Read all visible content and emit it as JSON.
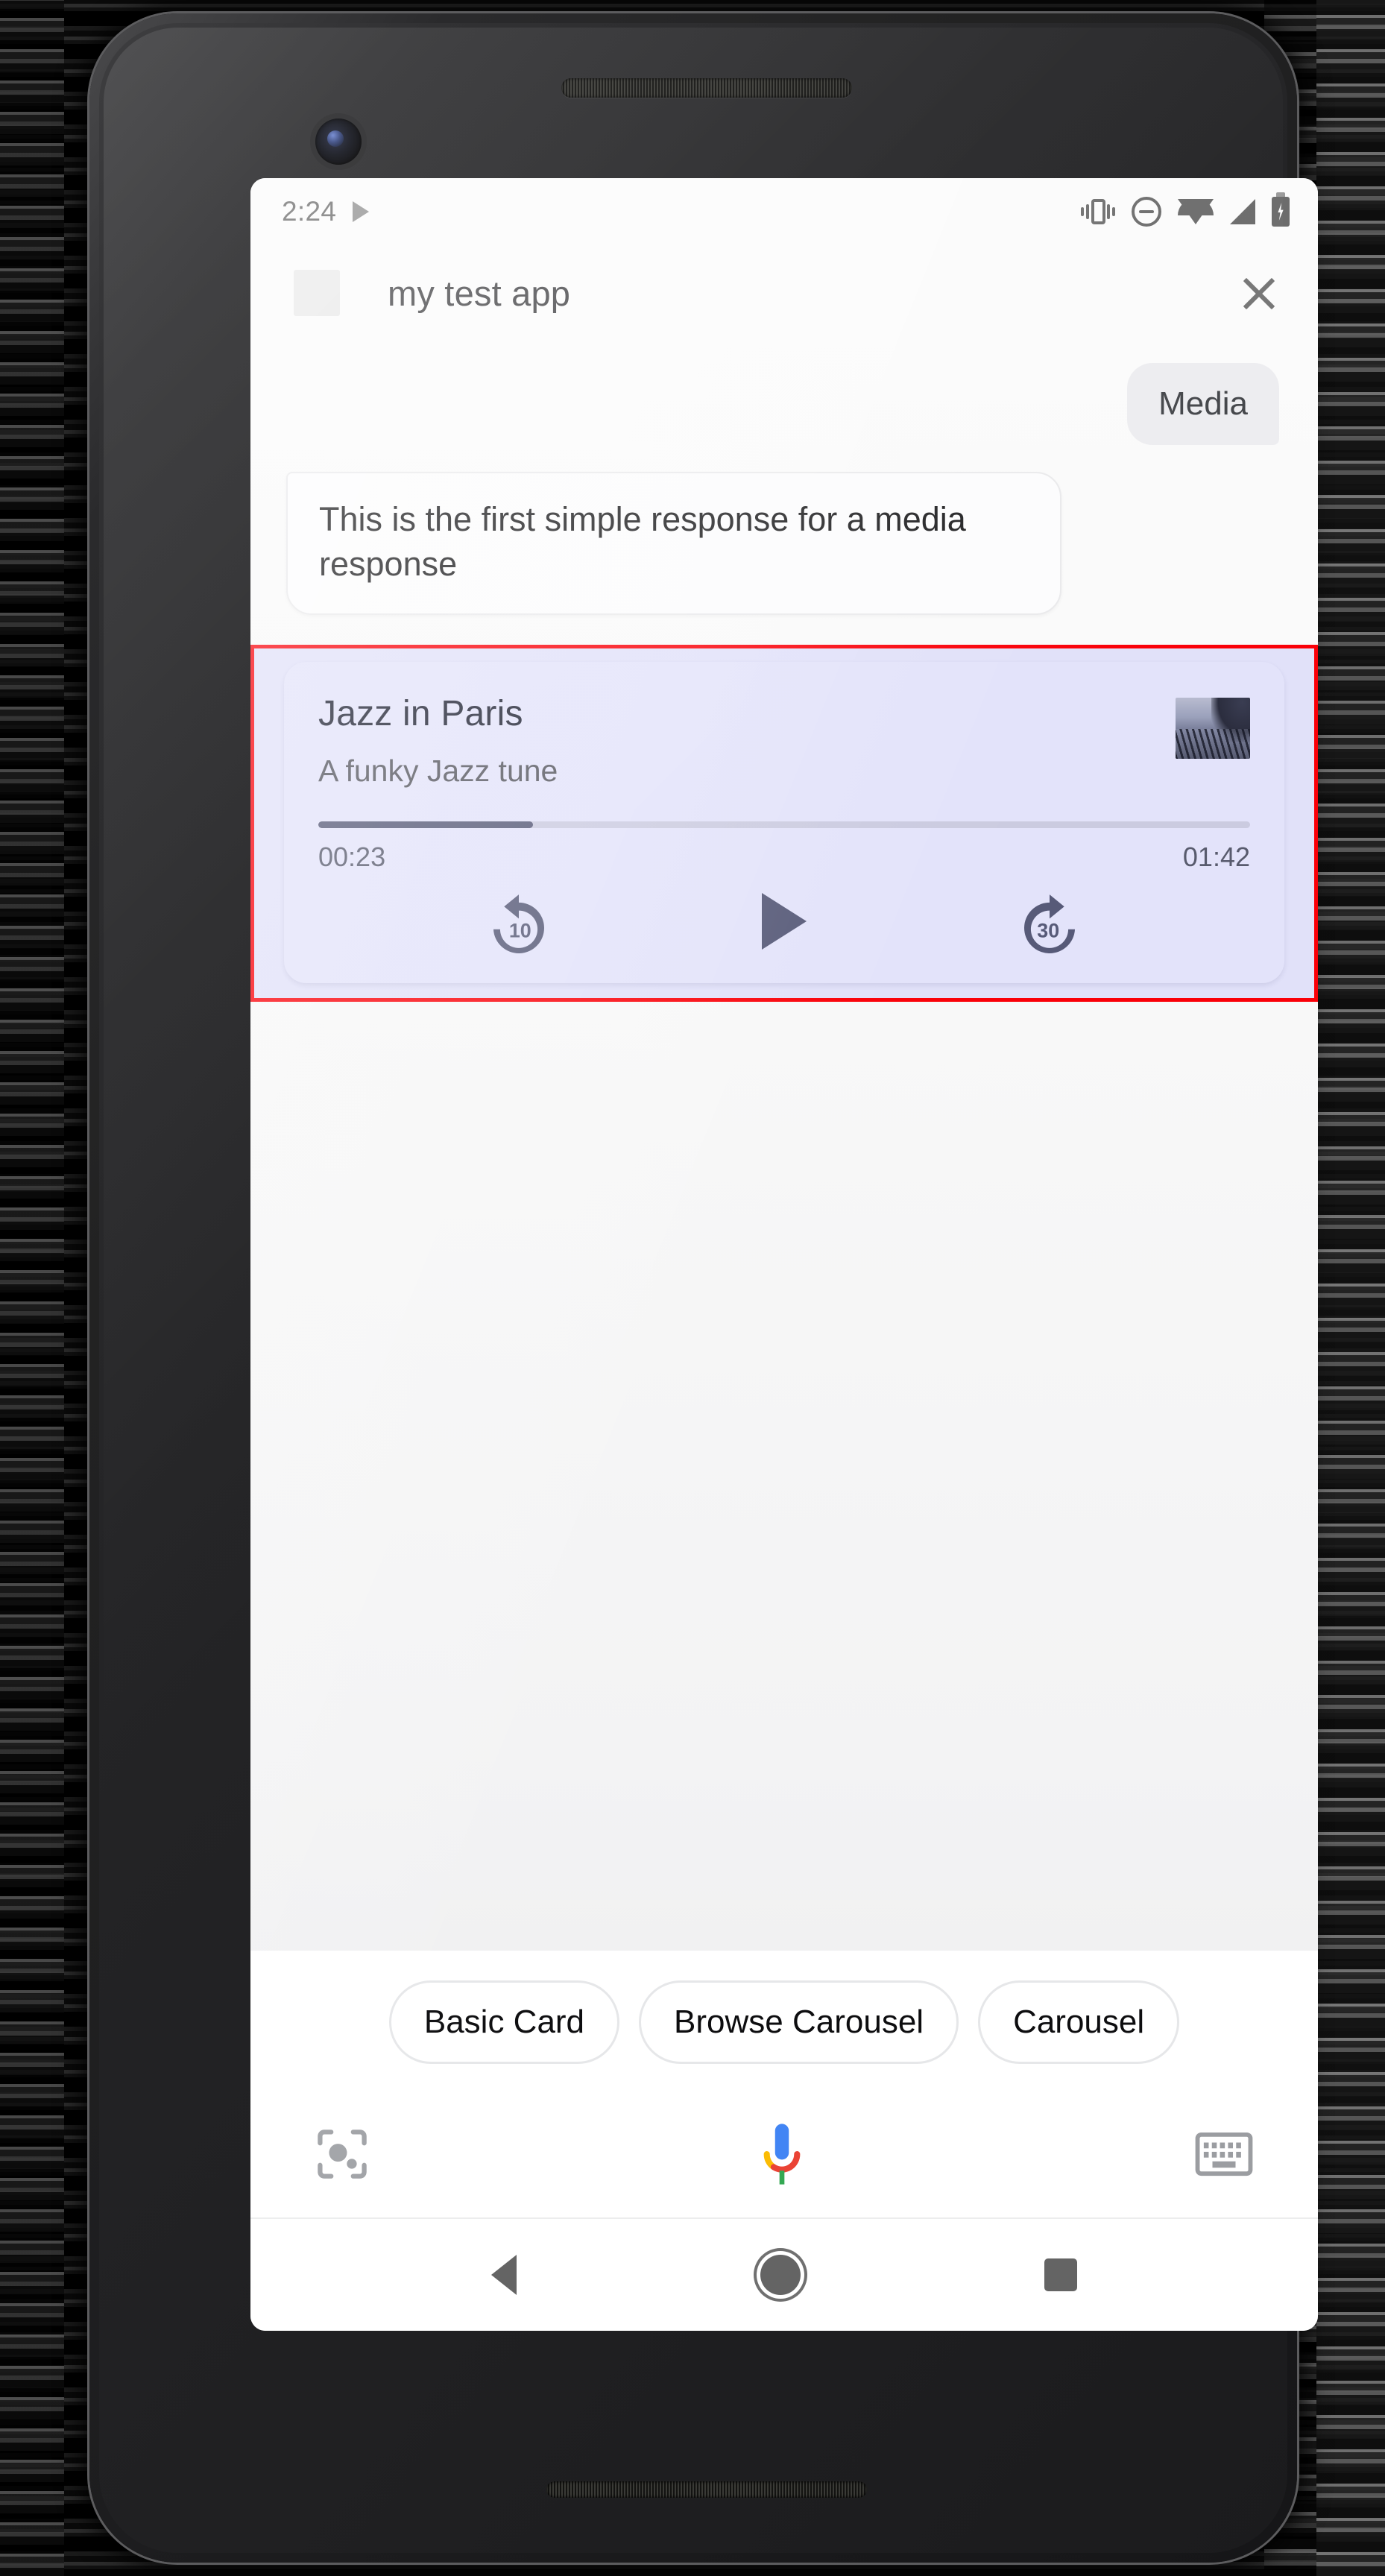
{
  "statusbar": {
    "time": "2:24",
    "icons": [
      "play-arrow-icon",
      "vibrate-icon",
      "do-not-disturb-icon",
      "wifi-icon",
      "cellular-signal-icon",
      "battery-charging-icon"
    ]
  },
  "header": {
    "app_icon": "app-placeholder-icon",
    "title": "my test app",
    "close_icon": "close-icon"
  },
  "conversation": {
    "user_message": "Media",
    "bot_message": "This is the first simple response for a media response"
  },
  "media_card": {
    "title": "Jazz in Paris",
    "subtitle": "A funky Jazz tune",
    "album_art": "album-art-thumbnail",
    "current_time": "00:23",
    "total_time": "01:42",
    "progress_percent": 23,
    "controls": {
      "rewind": "replay-10-icon",
      "rewind_label": "10",
      "play": "play-icon",
      "forward": "forward-30-icon",
      "forward_label": "30"
    },
    "highlight_color": "#fa0008",
    "background_color": "#e3e3fa",
    "accent_color": "#575a78"
  },
  "suggestions": [
    {
      "label": "Basic Card"
    },
    {
      "label": "Browse Carousel"
    },
    {
      "label": "Carousel"
    }
  ],
  "input_bar": {
    "lens": "google-lens-icon",
    "mic": "assistant-mic-icon",
    "keyboard": "keyboard-icon"
  },
  "navbar": {
    "back": "back-icon",
    "home": "home-icon",
    "recents": "recents-icon"
  }
}
